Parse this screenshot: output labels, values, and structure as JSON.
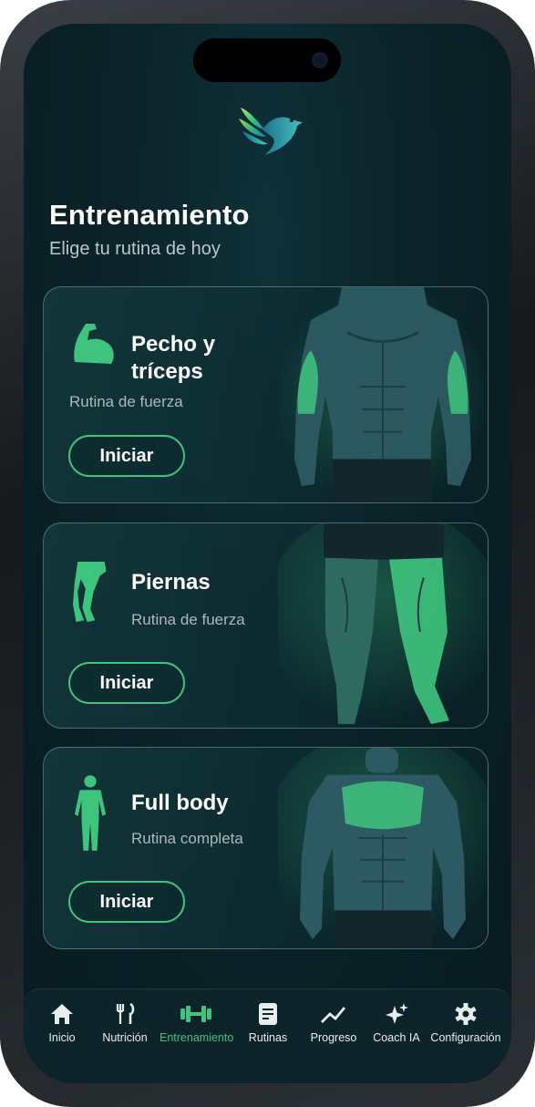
{
  "header": {
    "title": "Entrenamiento",
    "subtitle": "Elige tu rutina de hoy"
  },
  "cards": [
    {
      "title_line1": "Pecho y",
      "title_line2": "tríceps",
      "subtitle": "Rutina de fuerza",
      "button": "Iniciar",
      "icon": "flexed-arm-icon"
    },
    {
      "title_line1": "Piernas",
      "subtitle": "Rutina de fuerza",
      "button": "Iniciar",
      "icon": "legs-icon"
    },
    {
      "title_line1": "Full body",
      "subtitle": "Rutina completa",
      "button": "Iniciar",
      "icon": "full-body-icon"
    }
  ],
  "nav": {
    "items": [
      {
        "label": "Inicio",
        "icon": "home-icon",
        "active": false
      },
      {
        "label": "Nutrición",
        "icon": "fork-knife-icon",
        "active": false
      },
      {
        "label": "Entrenamiento",
        "icon": "dumbbell-icon",
        "active": true
      },
      {
        "label": "Rutinas",
        "icon": "document-icon",
        "active": false
      },
      {
        "label": "Progreso",
        "icon": "trend-icon",
        "active": false
      },
      {
        "label": "Coach IA",
        "icon": "sparkles-icon",
        "active": false
      },
      {
        "label": "Configuración",
        "icon": "gear-icon",
        "active": false
      }
    ]
  },
  "colors": {
    "accent": "#3fc47e",
    "background": "#0a2228",
    "text": "#ffffff",
    "muted": "#aab9bb"
  }
}
